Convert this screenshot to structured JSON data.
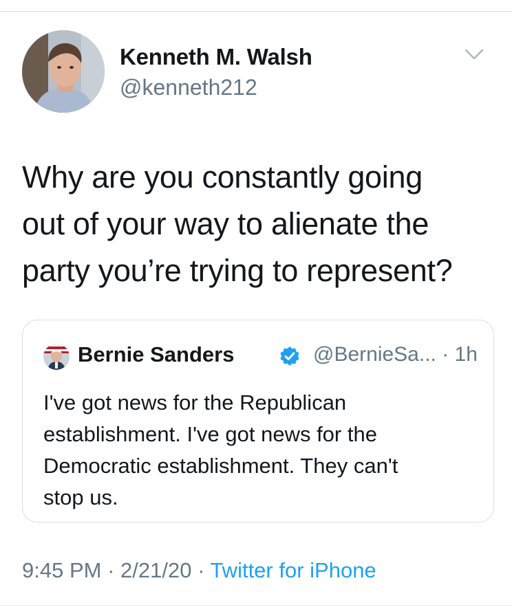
{
  "author": {
    "name": "Kenneth M. Walsh",
    "handle": "@kenneth212",
    "avatar_icon": "profile-photo"
  },
  "menu_icon": "chevron-down-icon",
  "tweet": {
    "text_lines": [
      "Why are you constantly going",
      "out of your way to alienate the",
      "party you’re trying to represent?"
    ]
  },
  "quoted_tweet": {
    "name": "Bernie Sanders",
    "verified": true,
    "handle_time": "@BernieSa... · 1h",
    "text_lines": [
      "I've got news for the Republican",
      "establishment. I've got news for the",
      "Democratic establishment. They can't",
      "stop us."
    ]
  },
  "meta": {
    "time": "9:45 PM",
    "separator1": " · ",
    "date": "2/21/20",
    "separator2": " · ",
    "source": "Twitter for iPhone"
  },
  "colors": {
    "text": "#14171a",
    "secondary": "#657786",
    "link": "#1da1f2",
    "border": "#d9dde1"
  }
}
